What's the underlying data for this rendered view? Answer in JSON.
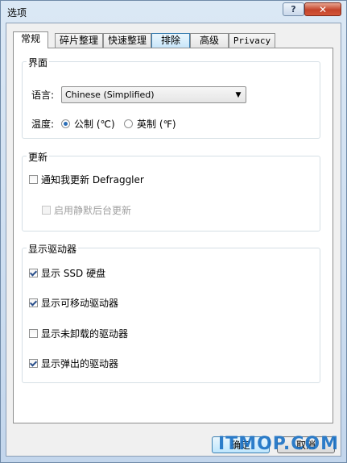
{
  "window": {
    "title": "选项",
    "help_glyph": "?",
    "close_glyph": "✕"
  },
  "tabs": [
    {
      "label": "常规",
      "active": true
    },
    {
      "label": "碎片整理"
    },
    {
      "label": "快速整理"
    },
    {
      "label": "排除"
    },
    {
      "label": "高级"
    },
    {
      "label": "Privacy"
    }
  ],
  "interface_group": {
    "title": "界面",
    "language_label": "语言:",
    "language_value": "Chinese (Simplified)",
    "temperature_label": "温度:",
    "celsius_label": "公制 (℃)",
    "fahrenheit_label": "英制 (℉)",
    "temperature_selected": "celsius"
  },
  "update_group": {
    "title": "更新",
    "notify_label": "通知我更新 Defraggler",
    "notify_checked": false,
    "silent_label": "启用静默后台更新",
    "silent_checked": false,
    "silent_enabled": false
  },
  "drives_group": {
    "title": "显示驱动器",
    "items": [
      {
        "label": "显示 SSD 硬盘",
        "checked": true
      },
      {
        "label": "显示可移动驱动器",
        "checked": true
      },
      {
        "label": "显示未卸载的驱动器",
        "checked": false
      },
      {
        "label": "显示弹出的驱动器",
        "checked": true
      }
    ]
  },
  "buttons": {
    "ok": "确定",
    "cancel": "取消"
  },
  "watermark": "ITMOP.COM",
  "colors": {
    "accent": "#3c7fb1",
    "close": "#c4432a",
    "watermark": "#1870c4"
  }
}
